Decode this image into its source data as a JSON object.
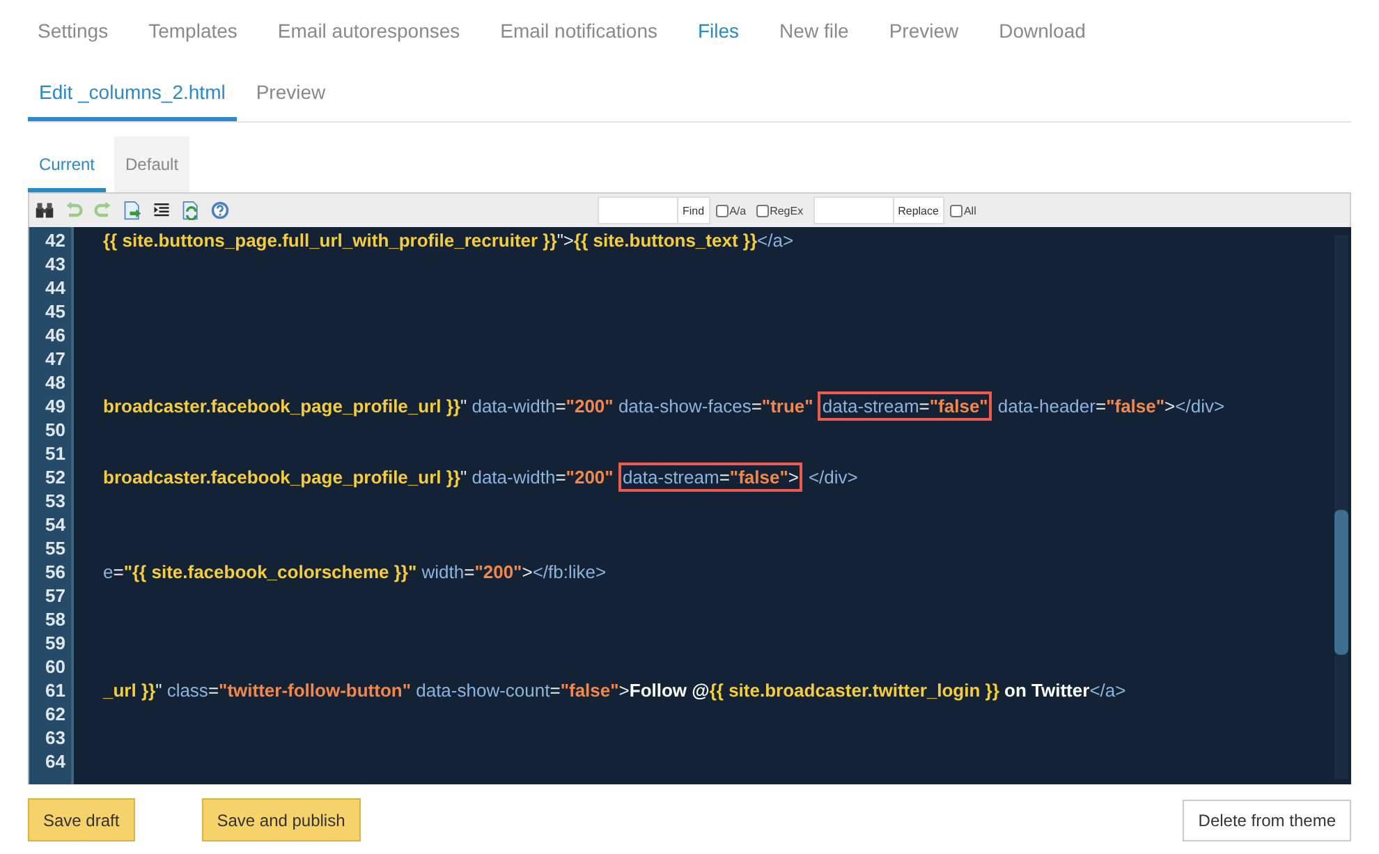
{
  "main_tabs": [
    {
      "label": "Settings",
      "selected": false
    },
    {
      "label": "Templates",
      "selected": false
    },
    {
      "label": "Email autoresponses",
      "selected": false
    },
    {
      "label": "Email notifications",
      "selected": false
    },
    {
      "label": "Files",
      "selected": true
    },
    {
      "label": "New file",
      "selected": false
    },
    {
      "label": "Preview",
      "selected": false
    },
    {
      "label": "Download",
      "selected": false
    }
  ],
  "file_tabs": [
    {
      "label": "Edit _columns_2.html",
      "selected": true
    },
    {
      "label": "Preview",
      "selected": false
    }
  ],
  "version_tabs": [
    {
      "label": "Current",
      "selected": true
    },
    {
      "label": "Default",
      "selected": false
    }
  ],
  "toolbar": {
    "find_button": "Find",
    "match_case": {
      "label": "A/a",
      "checked": false
    },
    "regex": {
      "label": "RegEx",
      "checked": false
    },
    "replace_button": "Replace",
    "replace_all": {
      "label": "All",
      "checked": false
    }
  },
  "editor": {
    "lines": [
      {
        "number": "42",
        "segments": [
          {
            "kind": "code",
            "tokens": [
              {
                "kind": "tmpl",
                "text": "{{ site.buttons_page.full_url_with_profile_recruiter }}"
              },
              {
                "kind": "punct",
                "text": "\">"
              },
              {
                "kind": "tmpl",
                "text": "{{ site.buttons_text }}"
              },
              {
                "kind": "tag",
                "text": "</a>"
              }
            ]
          }
        ]
      },
      {
        "number": "43"
      },
      {
        "number": "44"
      },
      {
        "number": "45"
      },
      {
        "number": "46"
      },
      {
        "number": "47"
      },
      {
        "number": "48"
      },
      {
        "number": "49",
        "segments": [
          {
            "kind": "code",
            "tokens": [
              {
                "kind": "tmpl",
                "text": "broadcaster.facebook_page_profile_url }}"
              },
              {
                "kind": "punct",
                "text": "\" "
              },
              {
                "kind": "attr",
                "text": "data-width"
              },
              {
                "kind": "punct",
                "text": "="
              },
              {
                "kind": "str",
                "text": "\"200\" "
              },
              {
                "kind": "attr",
                "text": "data-show-faces"
              },
              {
                "kind": "punct",
                "text": "="
              },
              {
                "kind": "str",
                "text": "\"true\" "
              }
            ]
          },
          {
            "kind": "highlight",
            "tokens": [
              {
                "kind": "attr",
                "text": "data-stream"
              },
              {
                "kind": "punct",
                "text": "="
              },
              {
                "kind": "str",
                "text": "\"false\""
              }
            ]
          },
          {
            "kind": "code",
            "tokens": [
              {
                "kind": "attr",
                "text": "data-header"
              },
              {
                "kind": "punct",
                "text": "="
              },
              {
                "kind": "str",
                "text": "\"false\""
              },
              {
                "kind": "punct",
                "text": ">"
              },
              {
                "kind": "tag",
                "text": "</div>"
              }
            ]
          }
        ]
      },
      {
        "number": "50"
      },
      {
        "number": "51"
      },
      {
        "number": "52",
        "segments": [
          {
            "kind": "code",
            "tokens": [
              {
                "kind": "tmpl",
                "text": "broadcaster.facebook_page_profile_url }}"
              },
              {
                "kind": "punct",
                "text": "\" "
              },
              {
                "kind": "attr",
                "text": "data-width"
              },
              {
                "kind": "punct",
                "text": "="
              },
              {
                "kind": "str",
                "text": "\"200\" "
              }
            ]
          },
          {
            "kind": "highlight",
            "tokens": [
              {
                "kind": "attr",
                "text": "data-stream"
              },
              {
                "kind": "punct",
                "text": "="
              },
              {
                "kind": "str",
                "text": "\"false\""
              },
              {
                "kind": "punct",
                "text": ">"
              }
            ]
          },
          {
            "kind": "code",
            "tokens": [
              {
                "kind": "tag",
                "text": "</div>"
              }
            ]
          }
        ]
      },
      {
        "number": "53"
      },
      {
        "number": "54"
      },
      {
        "number": "55"
      },
      {
        "number": "56",
        "segments": [
          {
            "kind": "code",
            "tokens": [
              {
                "kind": "attr",
                "text": "e"
              },
              {
                "kind": "punct",
                "text": "="
              },
              {
                "kind": "tmpl",
                "text": "\"{{ site.facebook_colorscheme }}\" "
              },
              {
                "kind": "attr",
                "text": "width"
              },
              {
                "kind": "punct",
                "text": "="
              },
              {
                "kind": "str",
                "text": "\"200\""
              },
              {
                "kind": "punct",
                "text": ">"
              },
              {
                "kind": "tag",
                "text": "</fb:like>"
              }
            ]
          }
        ]
      },
      {
        "number": "57"
      },
      {
        "number": "58"
      },
      {
        "number": "59"
      },
      {
        "number": "60"
      },
      {
        "number": "61",
        "segments": [
          {
            "kind": "code",
            "tokens": [
              {
                "kind": "tmpl",
                "text": "_url }}"
              },
              {
                "kind": "punct",
                "text": "\" "
              },
              {
                "kind": "attr",
                "text": "class"
              },
              {
                "kind": "punct",
                "text": "="
              },
              {
                "kind": "str",
                "text": "\"twitter-follow-button\" "
              },
              {
                "kind": "attr",
                "text": "data-show-count"
              },
              {
                "kind": "punct",
                "text": "="
              },
              {
                "kind": "str",
                "text": "\"false\""
              },
              {
                "kind": "punct",
                "text": ">"
              },
              {
                "kind": "text",
                "text": "Follow @"
              },
              {
                "kind": "tmpl",
                "text": "{{ site.broadcaster.twitter_login }}"
              },
              {
                "kind": "text",
                "text": " on Twitter"
              },
              {
                "kind": "tag",
                "text": "</a>"
              }
            ]
          }
        ]
      },
      {
        "number": "62"
      },
      {
        "number": "63"
      },
      {
        "number": "64"
      }
    ]
  },
  "actions": {
    "save_draft": "Save draft",
    "save_publish": "Save and publish",
    "delete": "Delete from theme"
  }
}
